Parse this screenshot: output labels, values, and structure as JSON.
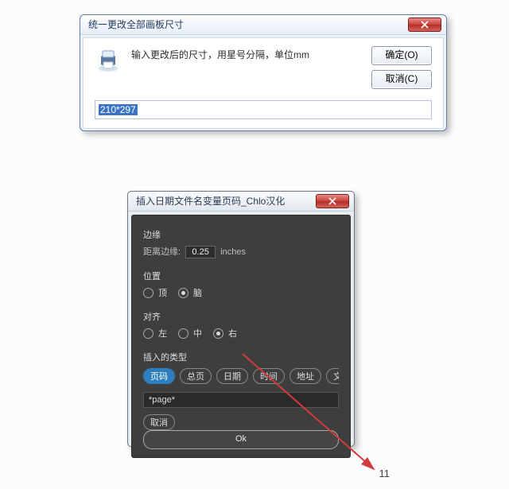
{
  "dialog1": {
    "title": "统一更改全部画板尺寸",
    "message": "输入更改后的尺寸，用星号分隔，单位mm",
    "ok_label": "确定(O)",
    "cancel_label": "取消(C)",
    "input_value": "210*297"
  },
  "dialog2": {
    "title": "插入日期文件名变量页码_Chlo汉化",
    "margin_section": "边缘",
    "margin_label": "距离边缘:",
    "margin_value": "0.25",
    "margin_unit": "inches",
    "position_section": "位置",
    "position_options": [
      "顶",
      "脑"
    ],
    "position_selected_index": 1,
    "align_section": "对齐",
    "align_options": [
      "左",
      "中",
      "右"
    ],
    "align_selected_index": 2,
    "type_section": "插入的类型",
    "type_chips": [
      "页码",
      "总页",
      "日期",
      "时间",
      "地址",
      "文件名"
    ],
    "type_selected_index": 0,
    "variable_value": "*page*",
    "cancel_label": "取消",
    "ok_label": "Ok"
  },
  "page_number": "11"
}
